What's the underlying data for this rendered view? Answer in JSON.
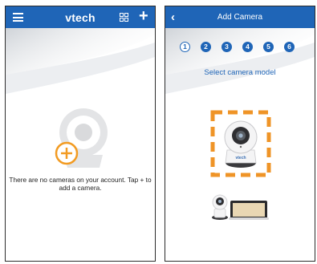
{
  "left_screen": {
    "header": {
      "menu_icon": "hamburger-menu-icon",
      "brand": "vtech",
      "grid_icon": "grid-view-icon",
      "add_icon": "plus-icon",
      "add_symbol": "+"
    },
    "empty_state": {
      "illustration": "camera-add-icon",
      "message": "There are no cameras on your account. Tap + to add a camera."
    }
  },
  "right_screen": {
    "header": {
      "back_icon": "back-chevron-icon",
      "back_symbol": "‹",
      "title": "Add Camera"
    },
    "steps": [
      {
        "label": "1",
        "state": "current"
      },
      {
        "label": "2",
        "state": "upcoming"
      },
      {
        "label": "3",
        "state": "upcoming"
      },
      {
        "label": "4",
        "state": "upcoming"
      },
      {
        "label": "5",
        "state": "upcoming"
      },
      {
        "label": "6",
        "state": "upcoming"
      }
    ],
    "prompt": "Select camera model",
    "models": [
      {
        "name": "pan-tilt-camera",
        "brand_mark": "vtech",
        "selected": true
      },
      {
        "name": "camera-monitor-kit",
        "selected": false
      }
    ]
  },
  "colors": {
    "header_blue": "#1f65b7",
    "accent_orange": "#f29b22",
    "selection_orange": "#ef9427"
  }
}
